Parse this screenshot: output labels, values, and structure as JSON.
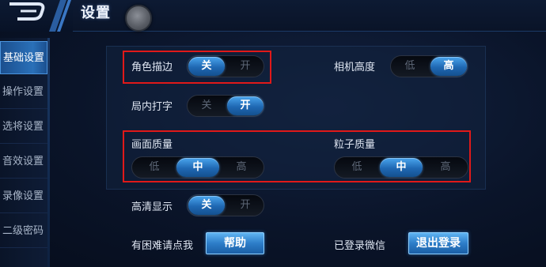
{
  "header": {
    "title": "设置"
  },
  "sidebar": {
    "items": [
      {
        "label": "基础设置",
        "active": true
      },
      {
        "label": "操作设置",
        "active": false
      },
      {
        "label": "选将设置",
        "active": false
      },
      {
        "label": "音效设置",
        "active": false
      },
      {
        "label": "录像设置",
        "active": false
      },
      {
        "label": "二级密码",
        "active": false
      }
    ]
  },
  "settings": {
    "outline": {
      "label": "角色描边",
      "options": [
        "关",
        "开"
      ],
      "selected": "关"
    },
    "camera_height": {
      "label": "相机高度",
      "options": [
        "低",
        "高"
      ],
      "selected": "高"
    },
    "inner_typing": {
      "label": "局内打字",
      "options": [
        "关",
        "开"
      ],
      "selected": "开"
    },
    "picture_quality": {
      "label": "画面质量",
      "options": [
        "低",
        "中",
        "高"
      ],
      "selected": "中"
    },
    "particle_quality": {
      "label": "粒子质量",
      "options": [
        "低",
        "中",
        "高"
      ],
      "selected": "中"
    },
    "hd_display": {
      "label": "高清显示",
      "options": [
        "关",
        "开"
      ],
      "selected": "关"
    },
    "help": {
      "label": "有困难请点我",
      "button": "帮助"
    },
    "wechat": {
      "label": "已登录微信",
      "button": "退出登录"
    }
  },
  "colors": {
    "accent": "#2a70b8",
    "highlight_box": "#e01919",
    "background": "#0a1429"
  }
}
